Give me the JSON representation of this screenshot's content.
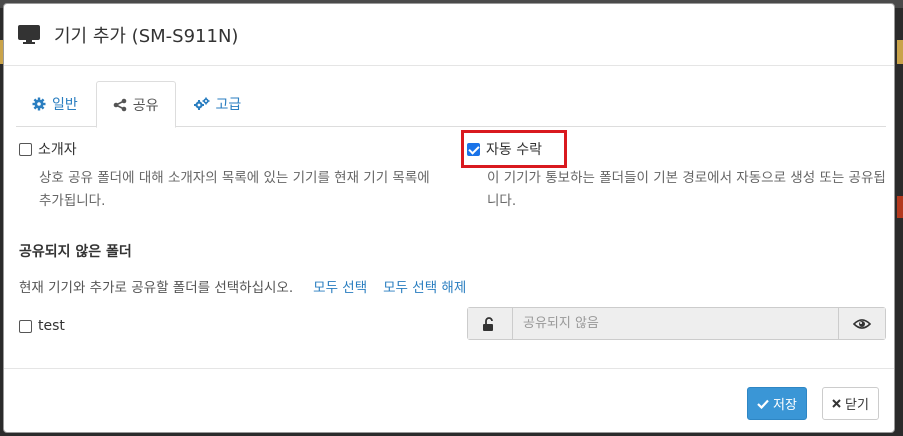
{
  "header": {
    "title": "기기 추가 (SM-S911N)",
    "icon": "monitor-icon"
  },
  "tabs": [
    {
      "label": "일반",
      "icon": "gear-icon",
      "active": false
    },
    {
      "label": "공유",
      "icon": "share-icon",
      "active": true
    },
    {
      "label": "고급",
      "icon": "gears-icon",
      "active": false
    }
  ],
  "introducer": {
    "label": "소개자",
    "checked": false,
    "help": "상호 공유 폴더에 대해 소개자의 목록에 있는 기기를 현재 기기 목록에 추가됩니다."
  },
  "auto_accept": {
    "label": "자동 수락",
    "checked": true,
    "help": "이 기기가 통보하는 폴더들이 기본 경로에서 자동으로 생성 또는 공유됩니다."
  },
  "unshared": {
    "title": "공유되지 않은 폴더",
    "desc": "현재 기기와 추가로 공유할 폴더를 선택하십시오.",
    "select_all": "모두 선택",
    "deselect_all": "모두 선택 해제",
    "folders": [
      {
        "name": "test",
        "checked": false,
        "placeholder": "공유되지 않음"
      }
    ]
  },
  "footer": {
    "save_label": "저장",
    "close_label": "닫기"
  },
  "colors": {
    "link": "#2a7ec0",
    "primary": "#3a96d6",
    "highlight": "#d9191f"
  }
}
